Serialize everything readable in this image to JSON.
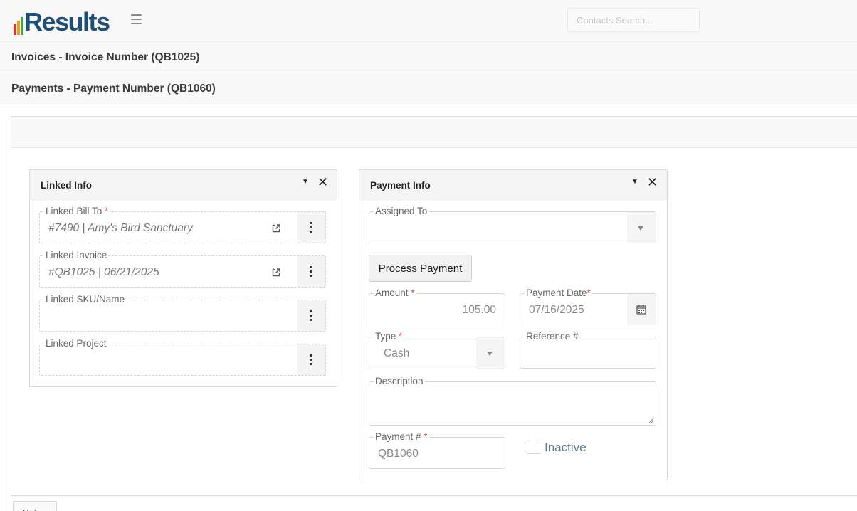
{
  "header": {
    "logo_text": "Results",
    "logo_bar_colors": [
      "#d9342b",
      "#f0a020",
      "#3aa34a"
    ],
    "menu_icon": "hamburger-menu-icon",
    "search_placeholder": "Contacts Search..."
  },
  "breadcrumbs": {
    "invoice_title": "Invoices - Invoice Number (QB1025)",
    "payment_title": "Payments - Payment Number (QB1060)"
  },
  "linked_info": {
    "title": "Linked Info",
    "collapse_icon": "caret-down-icon",
    "close_icon": "close-icon",
    "fields": [
      {
        "label": "Linked Bill To",
        "required": "*",
        "value": "#7490 | Amy's Bird Sanctuary",
        "has_link": true
      },
      {
        "label": "Linked Invoice",
        "required": "",
        "value": "#QB1025 | 06/21/2025",
        "has_link": true
      },
      {
        "label": "Linked SKU/Name",
        "required": "",
        "value": "",
        "has_link": false
      },
      {
        "label": "Linked Project",
        "required": "",
        "value": "",
        "has_link": false
      }
    ]
  },
  "payment_info": {
    "title": "Payment Info",
    "assigned_to": {
      "label": "Assigned To",
      "value": ""
    },
    "process_button": "Process Payment",
    "amount": {
      "label": "Amount",
      "required": "*",
      "value": "105.00"
    },
    "payment_date": {
      "label": "Payment Date",
      "required": "*",
      "value": "07/16/2025"
    },
    "type": {
      "label": "Type",
      "required": "*",
      "value": "Cash"
    },
    "reference": {
      "label": "Reference #",
      "value": ""
    },
    "description": {
      "label": "Description",
      "value": ""
    },
    "payment_number": {
      "label": "Payment #",
      "required": "*",
      "value": "QB1060"
    },
    "inactive": {
      "label": "Inactive",
      "checked": false
    }
  },
  "tabs": {
    "notes": "Notes"
  }
}
